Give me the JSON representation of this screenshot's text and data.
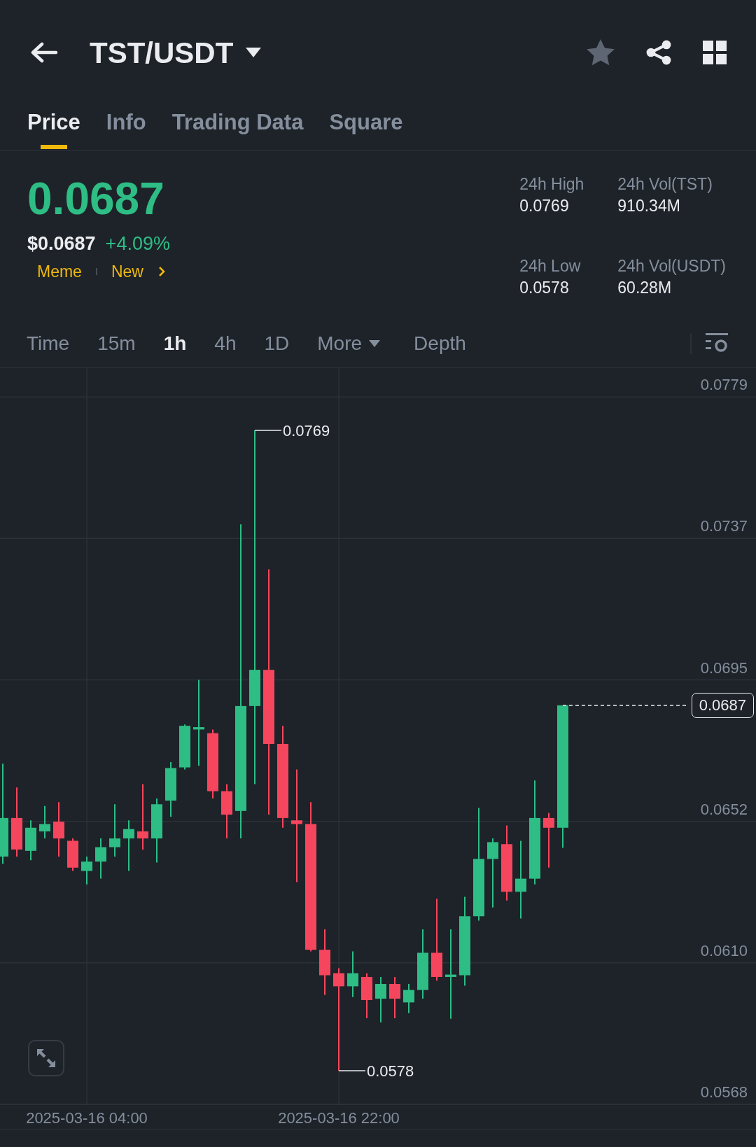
{
  "header": {
    "pair": "TST/USDT"
  },
  "tabs": [
    {
      "label": "Price",
      "selected": true
    },
    {
      "label": "Info",
      "selected": false
    },
    {
      "label": "Trading Data",
      "selected": false
    },
    {
      "label": "Square",
      "selected": false
    }
  ],
  "price": {
    "last": "0.0687",
    "usd": "$0.0687",
    "change": "+4.09%",
    "tags": [
      "Meme",
      "New"
    ]
  },
  "stats": [
    {
      "label": "24h High",
      "value": "0.0769"
    },
    {
      "label": "24h Vol(TST)",
      "value": "910.34M"
    },
    {
      "label": "24h Low",
      "value": "0.0578"
    },
    {
      "label": "24h Vol(USDT)",
      "value": "60.28M"
    }
  ],
  "intervals": [
    {
      "label": "Time",
      "selected": false,
      "kind": "plain"
    },
    {
      "label": "15m",
      "selected": false,
      "kind": "plain"
    },
    {
      "label": "1h",
      "selected": true,
      "kind": "plain"
    },
    {
      "label": "4h",
      "selected": false,
      "kind": "plain"
    },
    {
      "label": "1D",
      "selected": false,
      "kind": "plain"
    },
    {
      "label": "More",
      "selected": false,
      "kind": "dropdown"
    },
    {
      "label": "Depth",
      "selected": false,
      "kind": "plain"
    }
  ],
  "chart": {
    "price_labels": [
      "0.0779",
      "0.0737",
      "0.0695",
      "0.0652",
      "0.0610",
      "0.0568"
    ],
    "time_labels": [
      "2025-03-16 04:00",
      "2025-03-16 22:00"
    ],
    "high_label": "0.0769",
    "low_label": "0.0578",
    "last_price": "0.0687"
  }
}
